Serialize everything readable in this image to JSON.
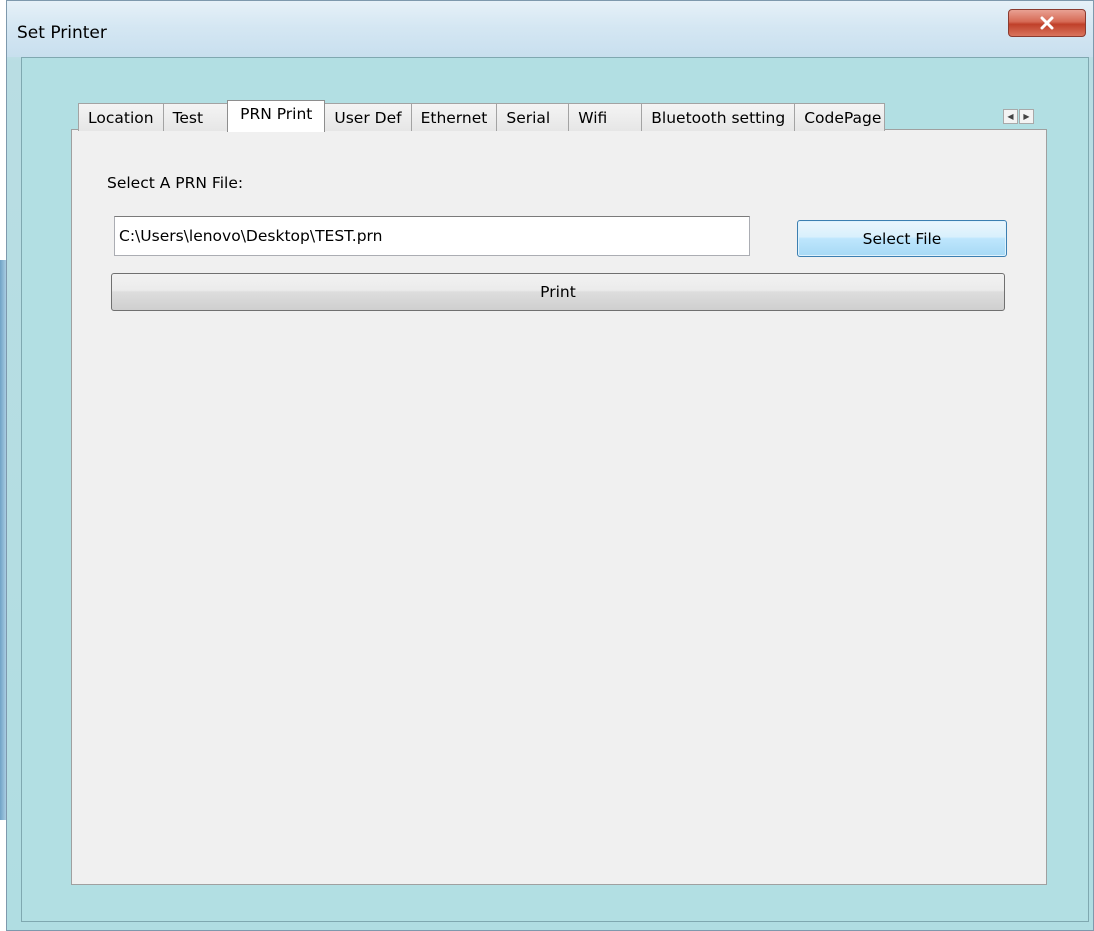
{
  "window": {
    "title": "Set Printer",
    "close_label": "close"
  },
  "tabs": [
    {
      "label": "Location",
      "active": false
    },
    {
      "label": "Test",
      "active": false
    },
    {
      "label": "PRN Print",
      "active": true
    },
    {
      "label": "User Def",
      "active": false
    },
    {
      "label": "Ethernet",
      "active": false
    },
    {
      "label": "Serial",
      "active": false
    },
    {
      "label": "Wifi",
      "active": false
    },
    {
      "label": "Bluetooth setting",
      "active": false
    },
    {
      "label": "CodePage",
      "active": false
    }
  ],
  "tab_scroll": {
    "left_icon": "chevron-left-icon",
    "right_icon": "chevron-right-icon"
  },
  "prn_print": {
    "file_label": "Select A PRN File:",
    "file_path": "C:\\Users\\lenovo\\Desktop\\TEST.prn",
    "select_button": "Select File",
    "print_button": "Print"
  },
  "colors": {
    "client_background": "#b2dfe3",
    "panel_background": "#f0f0f0",
    "close_button": "#c9503a"
  }
}
